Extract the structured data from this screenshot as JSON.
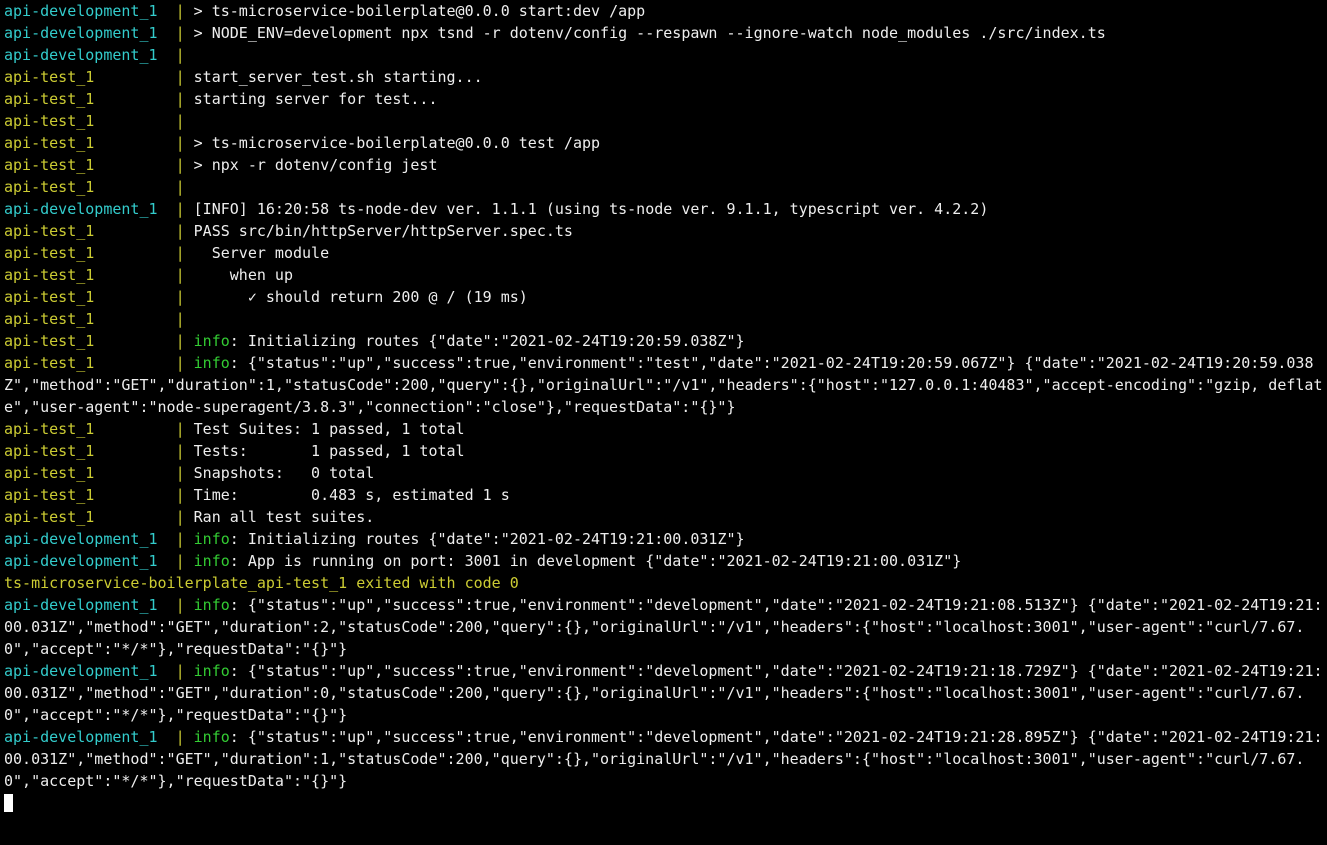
{
  "colors": {
    "cyan": "#33cccc",
    "yellow": "#cccc33",
    "green": "#33cc33",
    "white": "#eeeeee"
  },
  "lines": [
    {
      "segments": [
        {
          "text": "api-development_1  ",
          "color": "cyan"
        },
        {
          "text": "|",
          "color": "yellow"
        },
        {
          "text": " > ts-microservice-boilerplate@0.0.0 start:dev /app",
          "color": "white"
        }
      ]
    },
    {
      "segments": [
        {
          "text": "api-development_1  ",
          "color": "cyan"
        },
        {
          "text": "|",
          "color": "yellow"
        },
        {
          "text": " > NODE_ENV=development npx tsnd -r dotenv/config --respawn --ignore-watch node_modules ./src/index.ts",
          "color": "white"
        }
      ]
    },
    {
      "segments": [
        {
          "text": "api-development_1  ",
          "color": "cyan"
        },
        {
          "text": "|",
          "color": "yellow"
        }
      ]
    },
    {
      "segments": [
        {
          "text": "api-test_1         ",
          "color": "yellow"
        },
        {
          "text": "|",
          "color": "yellow"
        },
        {
          "text": " start_server_test.sh starting...",
          "color": "white"
        }
      ]
    },
    {
      "segments": [
        {
          "text": "api-test_1         ",
          "color": "yellow"
        },
        {
          "text": "|",
          "color": "yellow"
        },
        {
          "text": " starting server for test...",
          "color": "white"
        }
      ]
    },
    {
      "segments": [
        {
          "text": "api-test_1         ",
          "color": "yellow"
        },
        {
          "text": "|",
          "color": "yellow"
        }
      ]
    },
    {
      "segments": [
        {
          "text": "api-test_1         ",
          "color": "yellow"
        },
        {
          "text": "|",
          "color": "yellow"
        },
        {
          "text": " > ts-microservice-boilerplate@0.0.0 test /app",
          "color": "white"
        }
      ]
    },
    {
      "segments": [
        {
          "text": "api-test_1         ",
          "color": "yellow"
        },
        {
          "text": "|",
          "color": "yellow"
        },
        {
          "text": " > npx -r dotenv/config jest",
          "color": "white"
        }
      ]
    },
    {
      "segments": [
        {
          "text": "api-test_1         ",
          "color": "yellow"
        },
        {
          "text": "|",
          "color": "yellow"
        }
      ]
    },
    {
      "segments": [
        {
          "text": "api-development_1  ",
          "color": "cyan"
        },
        {
          "text": "|",
          "color": "yellow"
        },
        {
          "text": " [INFO] 16:20:58 ts-node-dev ver. 1.1.1 (using ts-node ver. 9.1.1, typescript ver. 4.2.2)",
          "color": "white"
        }
      ]
    },
    {
      "segments": [
        {
          "text": "api-test_1         ",
          "color": "yellow"
        },
        {
          "text": "|",
          "color": "yellow"
        },
        {
          "text": " PASS src/bin/httpServer/httpServer.spec.ts",
          "color": "white"
        }
      ]
    },
    {
      "segments": [
        {
          "text": "api-test_1         ",
          "color": "yellow"
        },
        {
          "text": "|",
          "color": "yellow"
        },
        {
          "text": "   Server module",
          "color": "white"
        }
      ]
    },
    {
      "segments": [
        {
          "text": "api-test_1         ",
          "color": "yellow"
        },
        {
          "text": "|",
          "color": "yellow"
        },
        {
          "text": "     when up",
          "color": "white"
        }
      ]
    },
    {
      "segments": [
        {
          "text": "api-test_1         ",
          "color": "yellow"
        },
        {
          "text": "|",
          "color": "yellow"
        },
        {
          "text": "       ✓ should return 200 @ / (19 ms)",
          "color": "white"
        }
      ]
    },
    {
      "segments": [
        {
          "text": "api-test_1         ",
          "color": "yellow"
        },
        {
          "text": "|",
          "color": "yellow"
        }
      ]
    },
    {
      "segments": [
        {
          "text": "api-test_1         ",
          "color": "yellow"
        },
        {
          "text": "|",
          "color": "yellow"
        },
        {
          "text": " ",
          "color": "white"
        },
        {
          "text": "info",
          "color": "green"
        },
        {
          "text": ": Initializing routes {\"date\":\"2021-02-24T19:20:59.038Z\"}",
          "color": "white"
        }
      ]
    },
    {
      "segments": [
        {
          "text": "api-test_1         ",
          "color": "yellow"
        },
        {
          "text": "|",
          "color": "yellow"
        },
        {
          "text": " ",
          "color": "white"
        },
        {
          "text": "info",
          "color": "green"
        },
        {
          "text": ": {\"status\":\"up\",\"success\":true,\"environment\":\"test\",\"date\":\"2021-02-24T19:20:59.067Z\"} {\"date\":\"2021-02-24T19:20:59.038Z\",\"method\":\"GET\",\"duration\":1,\"statusCode\":200,\"query\":{},\"originalUrl\":\"/v1\",\"headers\":{\"host\":\"127.0.0.1:40483\",\"accept-encoding\":\"gzip, deflate\",\"user-agent\":\"node-superagent/3.8.3\",\"connection\":\"close\"},\"requestData\":\"{}\"}",
          "color": "white"
        }
      ]
    },
    {
      "segments": [
        {
          "text": "api-test_1         ",
          "color": "yellow"
        },
        {
          "text": "|",
          "color": "yellow"
        },
        {
          "text": " Test Suites: 1 passed, 1 total",
          "color": "white"
        }
      ]
    },
    {
      "segments": [
        {
          "text": "api-test_1         ",
          "color": "yellow"
        },
        {
          "text": "|",
          "color": "yellow"
        },
        {
          "text": " Tests:       1 passed, 1 total",
          "color": "white"
        }
      ]
    },
    {
      "segments": [
        {
          "text": "api-test_1         ",
          "color": "yellow"
        },
        {
          "text": "|",
          "color": "yellow"
        },
        {
          "text": " Snapshots:   0 total",
          "color": "white"
        }
      ]
    },
    {
      "segments": [
        {
          "text": "api-test_1         ",
          "color": "yellow"
        },
        {
          "text": "|",
          "color": "yellow"
        },
        {
          "text": " Time:        0.483 s, estimated 1 s",
          "color": "white"
        }
      ]
    },
    {
      "segments": [
        {
          "text": "api-test_1         ",
          "color": "yellow"
        },
        {
          "text": "|",
          "color": "yellow"
        },
        {
          "text": " Ran all test suites.",
          "color": "white"
        }
      ]
    },
    {
      "segments": [
        {
          "text": "api-development_1  ",
          "color": "cyan"
        },
        {
          "text": "|",
          "color": "yellow"
        },
        {
          "text": " ",
          "color": "white"
        },
        {
          "text": "info",
          "color": "green"
        },
        {
          "text": ": Initializing routes {\"date\":\"2021-02-24T19:21:00.031Z\"}",
          "color": "white"
        }
      ]
    },
    {
      "segments": [
        {
          "text": "api-development_1  ",
          "color": "cyan"
        },
        {
          "text": "|",
          "color": "yellow"
        },
        {
          "text": " ",
          "color": "white"
        },
        {
          "text": "info",
          "color": "green"
        },
        {
          "text": ": App is running on port: 3001 in development {\"date\":\"2021-02-24T19:21:00.031Z\"}",
          "color": "white"
        }
      ]
    },
    {
      "segments": [
        {
          "text": "ts-microservice-boilerplate_api-test_1 exited with code 0",
          "color": "yellow"
        }
      ]
    },
    {
      "segments": [
        {
          "text": "api-development_1  ",
          "color": "cyan"
        },
        {
          "text": "|",
          "color": "yellow"
        },
        {
          "text": " ",
          "color": "white"
        },
        {
          "text": "info",
          "color": "green"
        },
        {
          "text": ": {\"status\":\"up\",\"success\":true,\"environment\":\"development\",\"date\":\"2021-02-24T19:21:08.513Z\"} {\"date\":\"2021-02-24T19:21:00.031Z\",\"method\":\"GET\",\"duration\":2,\"statusCode\":200,\"query\":{},\"originalUrl\":\"/v1\",\"headers\":{\"host\":\"localhost:3001\",\"user-agent\":\"curl/7.67.0\",\"accept\":\"*/*\"},\"requestData\":\"{}\"}",
          "color": "white"
        }
      ]
    },
    {
      "segments": [
        {
          "text": "api-development_1  ",
          "color": "cyan"
        },
        {
          "text": "|",
          "color": "yellow"
        },
        {
          "text": " ",
          "color": "white"
        },
        {
          "text": "info",
          "color": "green"
        },
        {
          "text": ": {\"status\":\"up\",\"success\":true,\"environment\":\"development\",\"date\":\"2021-02-24T19:21:18.729Z\"} {\"date\":\"2021-02-24T19:21:00.031Z\",\"method\":\"GET\",\"duration\":0,\"statusCode\":200,\"query\":{},\"originalUrl\":\"/v1\",\"headers\":{\"host\":\"localhost:3001\",\"user-agent\":\"curl/7.67.0\",\"accept\":\"*/*\"},\"requestData\":\"{}\"}",
          "color": "white"
        }
      ]
    },
    {
      "segments": [
        {
          "text": "api-development_1  ",
          "color": "cyan"
        },
        {
          "text": "|",
          "color": "yellow"
        },
        {
          "text": " ",
          "color": "white"
        },
        {
          "text": "info",
          "color": "green"
        },
        {
          "text": ": {\"status\":\"up\",\"success\":true,\"environment\":\"development\",\"date\":\"2021-02-24T19:21:28.895Z\"} {\"date\":\"2021-02-24T19:21:00.031Z\",\"method\":\"GET\",\"duration\":1,\"statusCode\":200,\"query\":{},\"originalUrl\":\"/v1\",\"headers\":{\"host\":\"localhost:3001\",\"user-agent\":\"curl/7.67.0\",\"accept\":\"*/*\"},\"requestData\":\"{}\"}",
          "color": "white"
        }
      ]
    }
  ]
}
